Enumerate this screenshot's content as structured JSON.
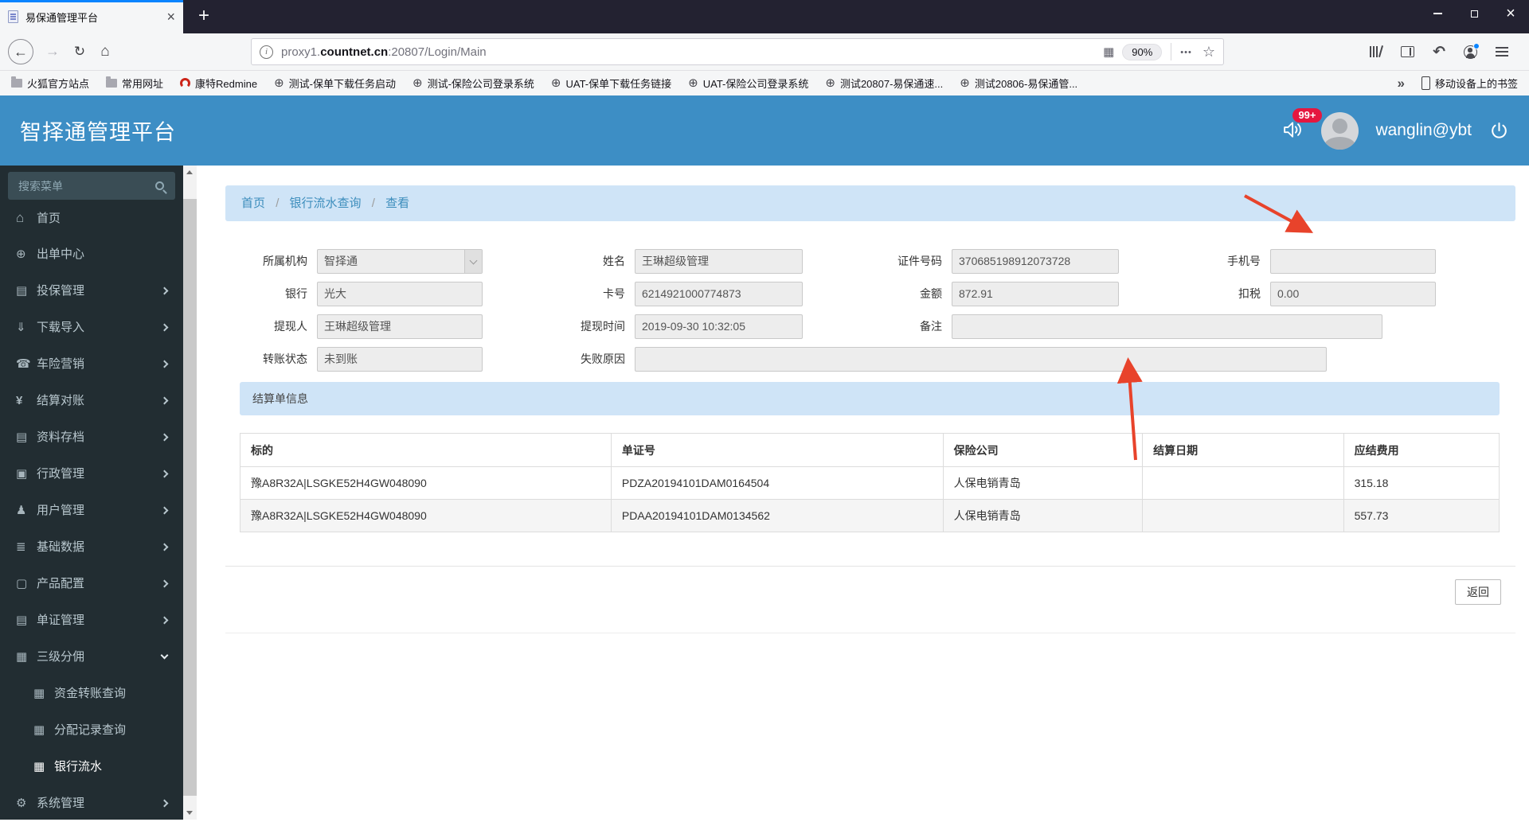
{
  "colors": {
    "firefox_accent": "#0a84ff",
    "header_blue": "#3d8ec5",
    "sidebar_dark": "#222d32",
    "panel_blue_bg": "#cfe4f7",
    "link_blue": "#3c8dbc",
    "badge_red": "#e5173f",
    "annotation_red": "#e8432b"
  },
  "browser": {
    "tab_title": "易保通管理平台",
    "url": {
      "prefix": "proxy1.",
      "domain": "countnet.cn",
      "suffix": ":20807/Login/Main",
      "zoom": "90%"
    },
    "bookmarks": [
      {
        "icon": "folder-icon",
        "label": "火狐官方站点"
      },
      {
        "icon": "folder-icon",
        "label": "常用网址"
      },
      {
        "icon": "redmine-icon",
        "label": "康特Redmine"
      },
      {
        "icon": "globe-icon",
        "label": "测试-保单下载任务启动"
      },
      {
        "icon": "globe-icon",
        "label": "测试-保险公司登录系统"
      },
      {
        "icon": "globe-icon",
        "label": "UAT-保单下载任务链接"
      },
      {
        "icon": "globe-icon",
        "label": "UAT-保险公司登录系统"
      },
      {
        "icon": "globe-icon",
        "label": "测试20807-易保通速..."
      },
      {
        "icon": "globe-icon",
        "label": "测试20806-易保通管..."
      }
    ],
    "mobile_bookmarks": "移动设备上的书签"
  },
  "header": {
    "title": "智择通管理平台",
    "notification_count": "99+",
    "username": "wanglin@ybt"
  },
  "sidebar": {
    "search_placeholder": "搜索菜单",
    "items": [
      {
        "icon": "home-icon",
        "label": "首页"
      },
      {
        "icon": "globe-icon",
        "label": "出单中心"
      },
      {
        "icon": "file-icon",
        "label": "投保管理"
      },
      {
        "icon": "download-icon",
        "label": "下载导入"
      },
      {
        "icon": "phone-icon",
        "label": "车险营销"
      },
      {
        "icon": "yen-icon",
        "label": "结算对账"
      },
      {
        "icon": "archive-icon",
        "label": "资料存档"
      },
      {
        "icon": "briefcase-icon",
        "label": "行政管理"
      },
      {
        "icon": "user-icon",
        "label": "用户管理"
      },
      {
        "icon": "database-icon",
        "label": "基础数据"
      },
      {
        "icon": "product-icon",
        "label": "产品配置"
      },
      {
        "icon": "certificate-icon",
        "label": "单证管理"
      },
      {
        "icon": "grid-icon",
        "label": "三级分佣"
      },
      {
        "icon": "grid-icon",
        "label": "资金转账查询"
      },
      {
        "icon": "grid-icon",
        "label": "分配记录查询"
      },
      {
        "icon": "grid-icon",
        "label": "银行流水"
      },
      {
        "icon": "gear-icon",
        "label": "系统管理"
      }
    ]
  },
  "breadcrumb": {
    "items": [
      "首页",
      "银行流水查询",
      "查看"
    ],
    "separator": "/"
  },
  "form": {
    "fields": [
      {
        "label": "所属机构",
        "value": "智择通"
      },
      {
        "label": "姓名",
        "value": "王琳超级管理"
      },
      {
        "label": "证件号码",
        "value": "370685198912073728"
      },
      {
        "label": "手机号",
        "value": ""
      },
      {
        "label": "银行",
        "value": "光大"
      },
      {
        "label": "卡号",
        "value": "6214921000774873"
      },
      {
        "label": "金额",
        "value": "872.91"
      },
      {
        "label": "扣税",
        "value": "0.00"
      },
      {
        "label": "提现人",
        "value": "王琳超级管理"
      },
      {
        "label": "提现时间",
        "value": "2019-09-30 10:32:05"
      },
      {
        "label": "备注",
        "value": ""
      },
      {
        "label": "转账状态",
        "value": "未到账"
      },
      {
        "label": "失败原因",
        "value": ""
      }
    ]
  },
  "settlement": {
    "section_title": "结算单信息",
    "table": {
      "headers": [
        "标的",
        "单证号",
        "保险公司",
        "结算日期",
        "应结费用"
      ],
      "rows": [
        [
          "豫A8R32A|LSGKE52H4GW048090",
          "PDZA20194101DAM0164504",
          "人保电销青岛",
          "",
          "315.18"
        ],
        [
          "豫A8R32A|LSGKE52H4GW048090",
          "PDAA20194101DAM0134562",
          "人保电销青岛",
          "",
          "557.73"
        ]
      ]
    },
    "back_button": "返回"
  }
}
